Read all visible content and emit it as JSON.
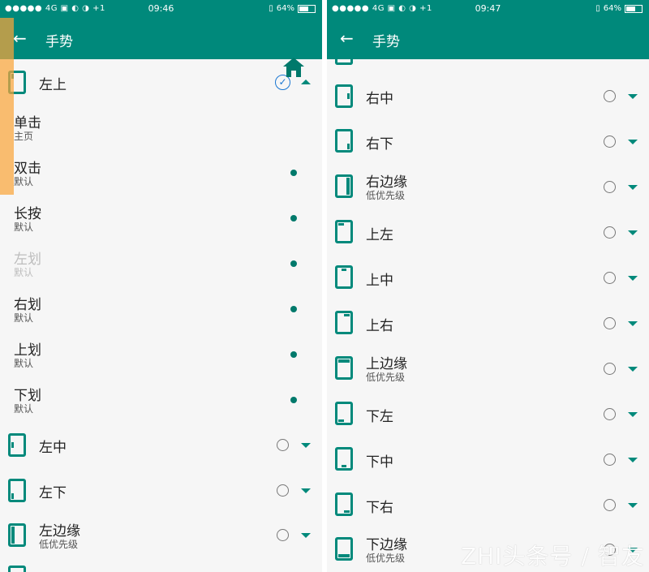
{
  "left_phone": {
    "status": {
      "signal": "●●●●●",
      "network": "4G",
      "extras": "+1",
      "time": "09:46",
      "battery": "64%",
      "battery_level": 0.64
    },
    "appbar": {
      "title": "手势"
    },
    "top_row": {
      "label": "左上"
    },
    "actions": [
      {
        "title": "单击",
        "sub": "主页"
      },
      {
        "title": "双击",
        "sub": "默认"
      },
      {
        "title": "长按",
        "sub": "默认"
      },
      {
        "title": "左划",
        "sub": "默认",
        "disabled": true
      },
      {
        "title": "右划",
        "sub": "默认"
      },
      {
        "title": "上划",
        "sub": "默认"
      },
      {
        "title": "下划",
        "sub": "默认"
      }
    ],
    "bottom_rows": [
      {
        "title": "左中",
        "sub": ""
      },
      {
        "title": "左下",
        "sub": ""
      },
      {
        "title": "左边缘",
        "sub": "低优先级"
      }
    ]
  },
  "right_phone": {
    "status": {
      "signal": "●●●●●",
      "network": "4G",
      "extras": "+1",
      "time": "09:47",
      "battery": "64%",
      "battery_level": 0.64
    },
    "appbar": {
      "title": "手势"
    },
    "rows": [
      {
        "title": "右中",
        "sub": ""
      },
      {
        "title": "右下",
        "sub": ""
      },
      {
        "title": "右边缘",
        "sub": "低优先级"
      },
      {
        "title": "上左",
        "sub": ""
      },
      {
        "title": "上中",
        "sub": ""
      },
      {
        "title": "上右",
        "sub": ""
      },
      {
        "title": "上边缘",
        "sub": "低优先级"
      },
      {
        "title": "下左",
        "sub": ""
      },
      {
        "title": "下中",
        "sub": ""
      },
      {
        "title": "下右",
        "sub": ""
      },
      {
        "title": "下边缘",
        "sub": "低优先级"
      }
    ]
  },
  "watermark": "ZHI头条号 / 智友",
  "colors": {
    "accent": "#00897b",
    "check": "#1976d2",
    "overlay": "#f9a53a"
  }
}
